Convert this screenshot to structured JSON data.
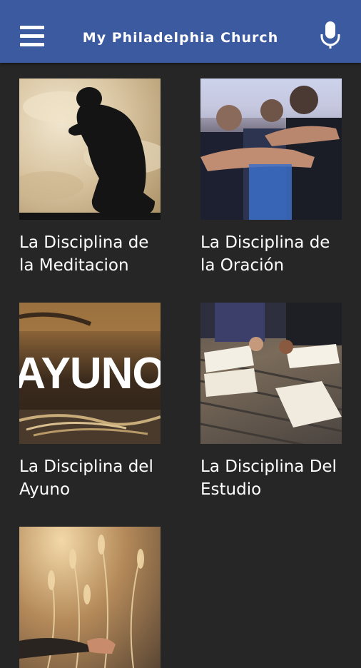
{
  "app": {
    "title": "My Philadelphia Church",
    "menu_icon": "hamburger-menu-icon",
    "mic_icon": "microphone-icon",
    "accent": "#3b5aa0",
    "background": "#262626"
  },
  "items": [
    {
      "caption": "La Disciplina de la Meditacion"
    },
    {
      "caption": "La Disciplina de la Oración"
    },
    {
      "caption": "La Disciplina del Ayuno",
      "image_text": "AYUNO"
    },
    {
      "caption": "La Disciplina Del Estudio"
    },
    {
      "caption": ""
    }
  ]
}
